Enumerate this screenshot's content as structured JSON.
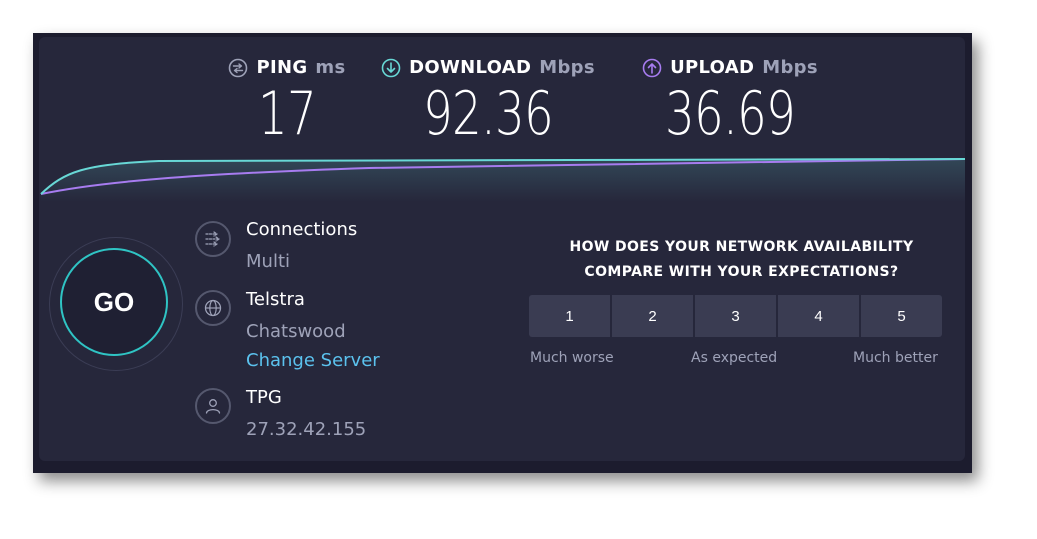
{
  "metrics": {
    "ping": {
      "label": "PING",
      "unit": "ms",
      "value": "17"
    },
    "download": {
      "label": "DOWNLOAD",
      "unit": "Mbps",
      "value": "92.36"
    },
    "upload": {
      "label": "UPLOAD",
      "unit": "Mbps",
      "value": "36.69"
    }
  },
  "go_label": "GO",
  "connections": {
    "title": "Connections",
    "value": "Multi"
  },
  "server": {
    "name": "Telstra",
    "location": "Chatswood",
    "change_label": "Change Server"
  },
  "provider": {
    "name": "TPG",
    "ip": "27.32.42.155"
  },
  "survey": {
    "question_line1": "HOW DOES YOUR NETWORK AVAILABILITY",
    "question_line2": "COMPARE WITH YOUR EXPECTATIONS?",
    "options": [
      "1",
      "2",
      "3",
      "4",
      "5"
    ],
    "label_low": "Much worse",
    "label_mid": "As expected",
    "label_high": "Much better"
  },
  "colors": {
    "background": "#26273b",
    "download_accent": "#68d8d6",
    "upload_accent": "#a77cf0",
    "go_ring": "#2fc4c4",
    "link": "#5bc2ee"
  },
  "icons": {
    "ping": "ping-icon",
    "download": "download-arrow-icon",
    "upload": "upload-arrow-icon",
    "connections": "connections-icon",
    "server": "globe-icon",
    "provider": "user-icon"
  }
}
